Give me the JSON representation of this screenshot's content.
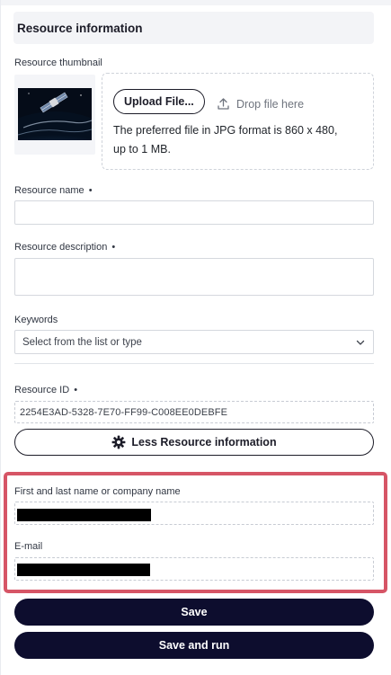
{
  "section": {
    "title": "Resource information"
  },
  "thumbnail": {
    "label": "Resource thumbnail",
    "upload_button": "Upload File...",
    "drop_hint": "Drop file here",
    "note_line1": "The preferred file in JPG format is 860 x 480,",
    "note_line2": "up to 1 MB."
  },
  "resource_name": {
    "label": "Resource name",
    "required_mark": "•",
    "value": ""
  },
  "resource_description": {
    "label": "Resource description",
    "required_mark": "•",
    "value": ""
  },
  "keywords": {
    "label": "Keywords",
    "placeholder": "Select from the list or type"
  },
  "resource_id": {
    "label": "Resource ID",
    "required_mark": "•",
    "value": "2254E3AD-5328-7E70-FF99-C008EE0DEBFE"
  },
  "toggle_button": {
    "label": "Less Resource information",
    "icon": "gear-icon"
  },
  "contact": {
    "name_label": "First and last name or company name",
    "email_label": "E-mail",
    "highlight_color": "#d65566"
  },
  "actions": {
    "save": "Save",
    "save_and_run": "Save and run"
  },
  "colors": {
    "primary": "#0d0d2e",
    "header_bg": "#f3f4f7"
  }
}
